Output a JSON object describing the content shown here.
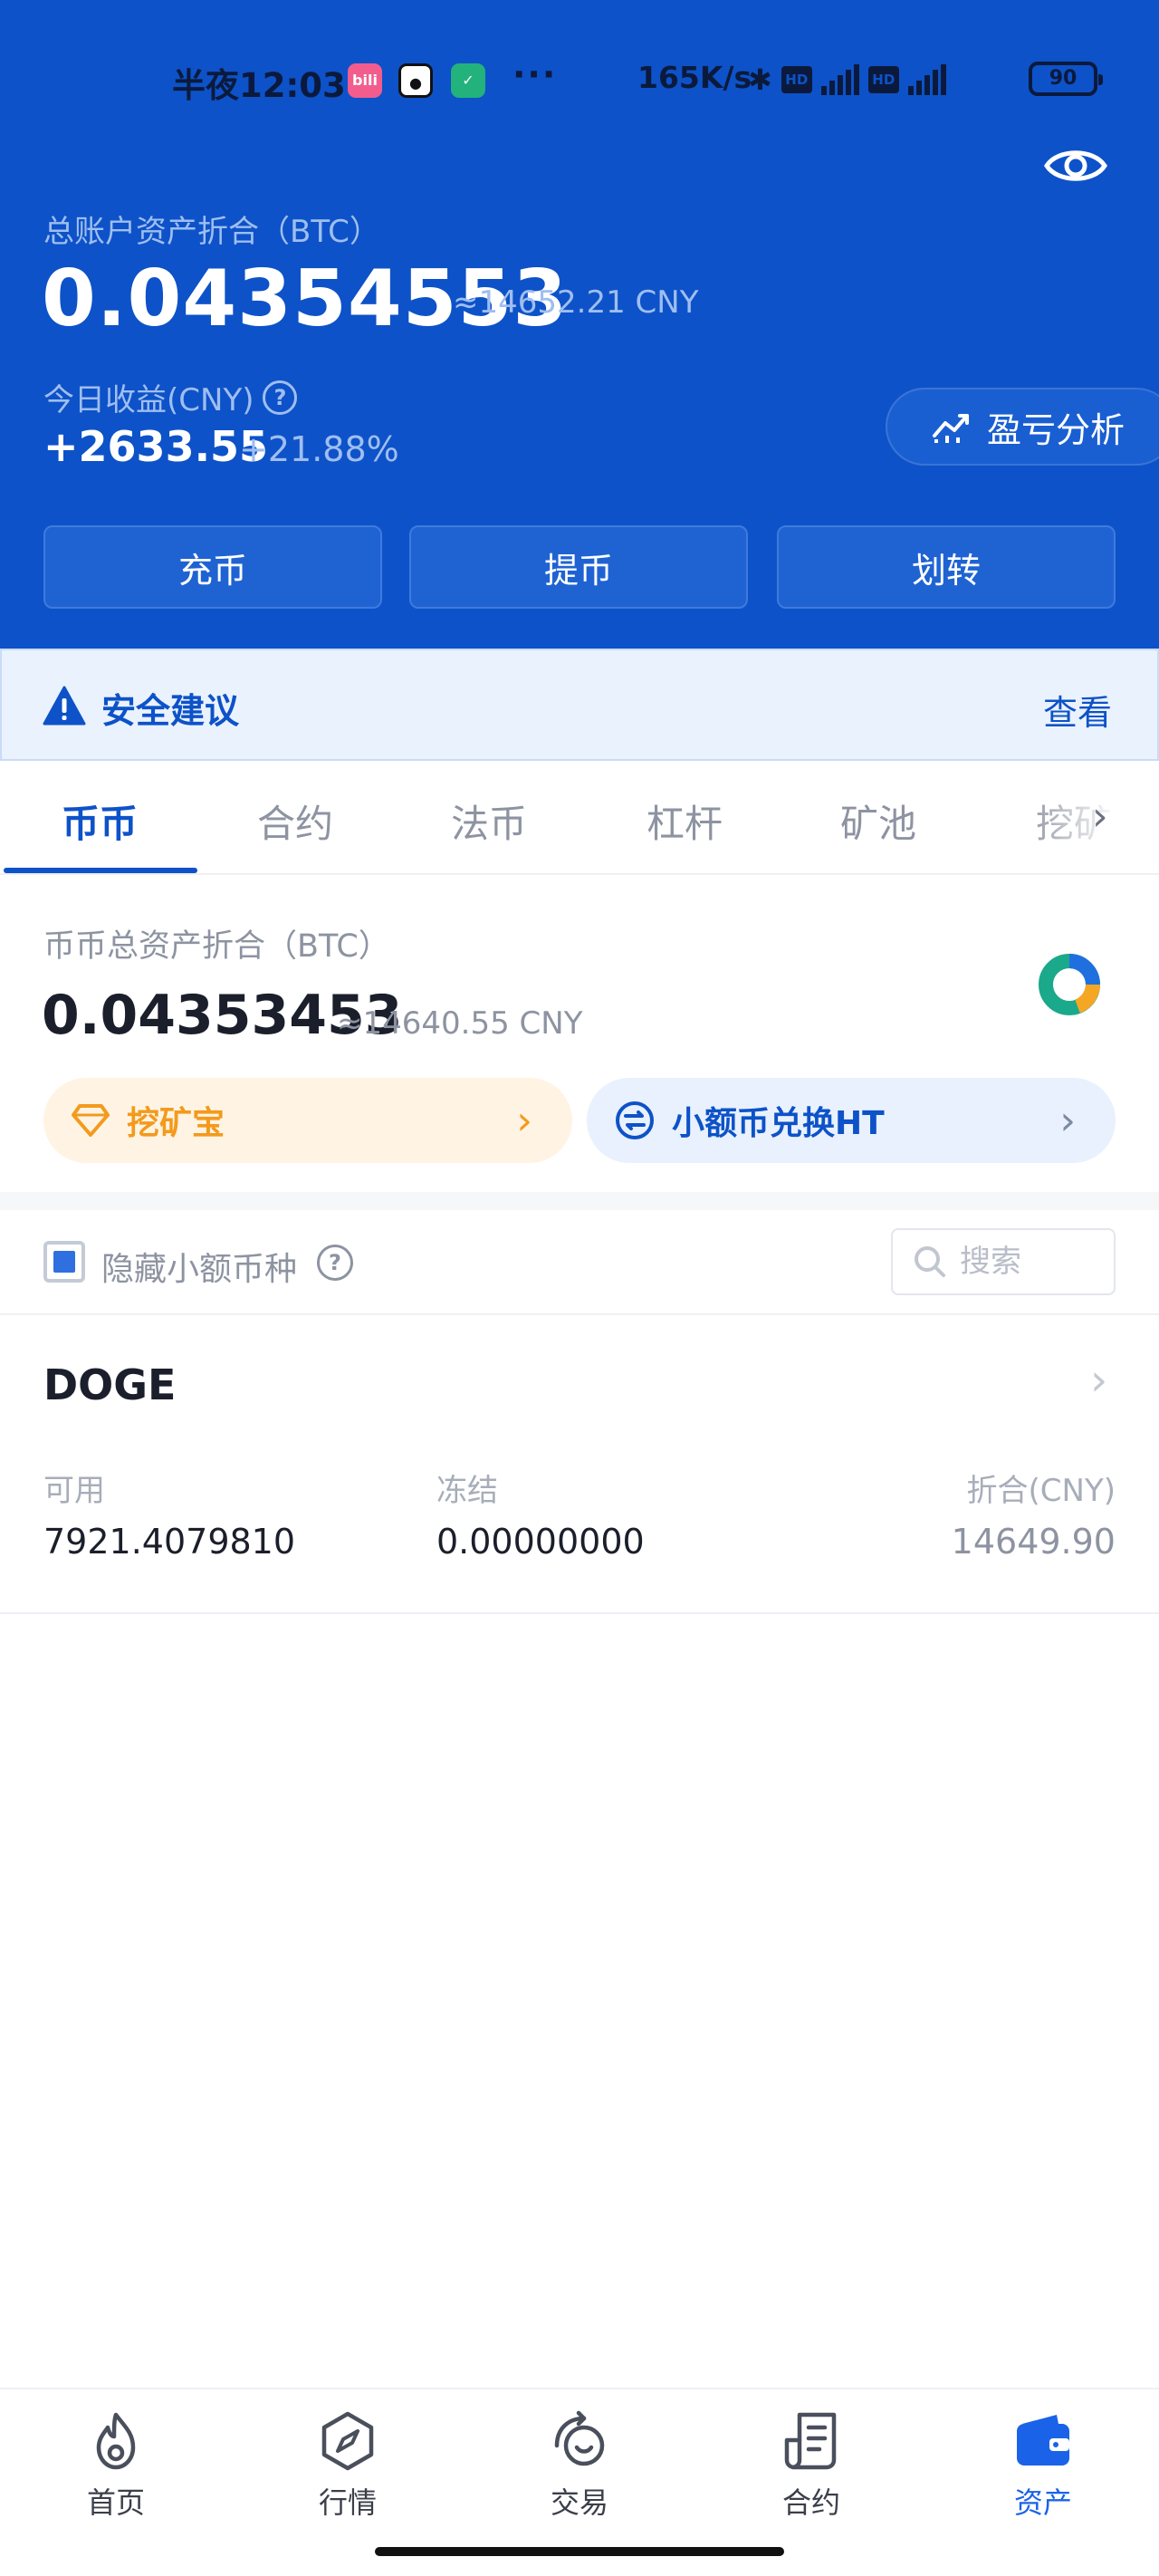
{
  "status_bar": {
    "time": "半夜12:03",
    "net_speed": "165K/s",
    "battery": "90",
    "apps": [
      "bilibili-icon",
      "qq-icon",
      "shield-app-icon"
    ]
  },
  "header": {
    "total_label": "总账户资产折合（BTC）",
    "total_btc": "0.04354553",
    "total_cny": "≈14652.21 CNY",
    "today_label": "今日收益(CNY)",
    "today_value": "+2633.55",
    "today_percent": "+21.88%",
    "pnl_button": "盈亏分析",
    "actions": {
      "deposit": "充币",
      "withdraw": "提币",
      "transfer": "划转"
    }
  },
  "security": {
    "label": "安全建议",
    "view": "查看"
  },
  "tabs": [
    {
      "label": "币币",
      "active": true
    },
    {
      "label": "合约",
      "active": false
    },
    {
      "label": "法币",
      "active": false
    },
    {
      "label": "杠杆",
      "active": false
    },
    {
      "label": "矿池",
      "active": false
    },
    {
      "label": "挖矿",
      "active": false
    }
  ],
  "spot": {
    "label": "币币总资产折合（BTC）",
    "total_btc": "0.04353453",
    "total_cny": "≈14640.55 CNY",
    "mining_pill": "挖矿宝",
    "exchange_pill": "小额币兑换HT"
  },
  "filter": {
    "hide_small_label": "隐藏小额币种",
    "hide_small_checked": true,
    "search_placeholder": "搜索"
  },
  "assets": [
    {
      "coin": "DOGE",
      "available_label": "可用",
      "available": "7921.4079810",
      "frozen_label": "冻结",
      "frozen": "0.00000000",
      "value_label": "折合(CNY)",
      "value": "14649.90"
    }
  ],
  "bottom_nav": [
    {
      "label": "首页",
      "icon": "flame-icon",
      "active": false
    },
    {
      "label": "行情",
      "icon": "compass-icon",
      "active": false
    },
    {
      "label": "交易",
      "icon": "exchange-icon",
      "active": false
    },
    {
      "label": "合约",
      "icon": "document-icon",
      "active": false
    },
    {
      "label": "资产",
      "icon": "wallet-icon",
      "active": true
    }
  ],
  "colors": {
    "primary": "#0d52c8",
    "accent_orange": "#f39a1d",
    "nav_active": "#1a63e8"
  }
}
